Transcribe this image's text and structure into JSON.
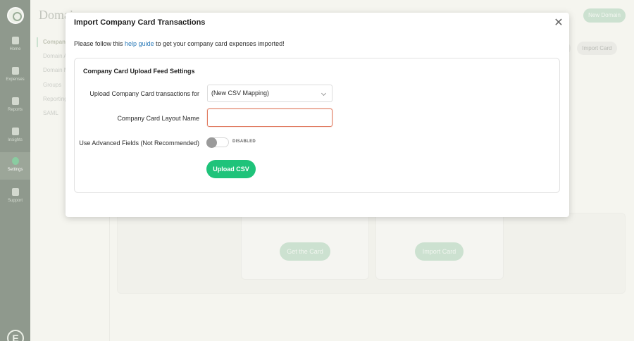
{
  "background": {
    "page_title": "Domains",
    "new_domain_label": "New Domain",
    "import_card_label": "Import Card",
    "subnav": [
      "Company",
      "Domain A",
      "Domain M",
      "Groups",
      "Reporting",
      "SAML"
    ],
    "get_card_label": "Get the Card",
    "import_card_button_label": "Import Card"
  },
  "rail": {
    "items": [
      {
        "label": "Home",
        "icon": "home-icon"
      },
      {
        "label": "Expenses",
        "icon": "receipt-icon"
      },
      {
        "label": "Reports",
        "icon": "reports-icon"
      },
      {
        "label": "Insights",
        "icon": "insights-icon"
      },
      {
        "label": "Settings",
        "icon": "gear-icon"
      },
      {
        "label": "Support",
        "icon": "chat-icon"
      }
    ],
    "bottom_logo": "E"
  },
  "modal": {
    "title": "Import Company Card Transactions",
    "close_glyph": "✕",
    "intro_before": "Please follow this ",
    "intro_link": "help guide",
    "intro_after": " to get your company card expenses imported!",
    "panel_title": "Company Card Upload Feed Settings",
    "upload_for_label": "Upload Company Card transactions for",
    "upload_for_value": "(New CSV Mapping)",
    "layout_name_label": "Company Card Layout Name",
    "layout_name_value": "",
    "advanced_label": "Use Advanced Fields (Not Recommended)",
    "advanced_status": "DISABLED",
    "upload_button": "Upload CSV"
  },
  "colors": {
    "accent": "#1fc37a",
    "link": "#2a7ab8",
    "input_error_border": "#e07a5f",
    "rail": "#5b6b5b"
  }
}
